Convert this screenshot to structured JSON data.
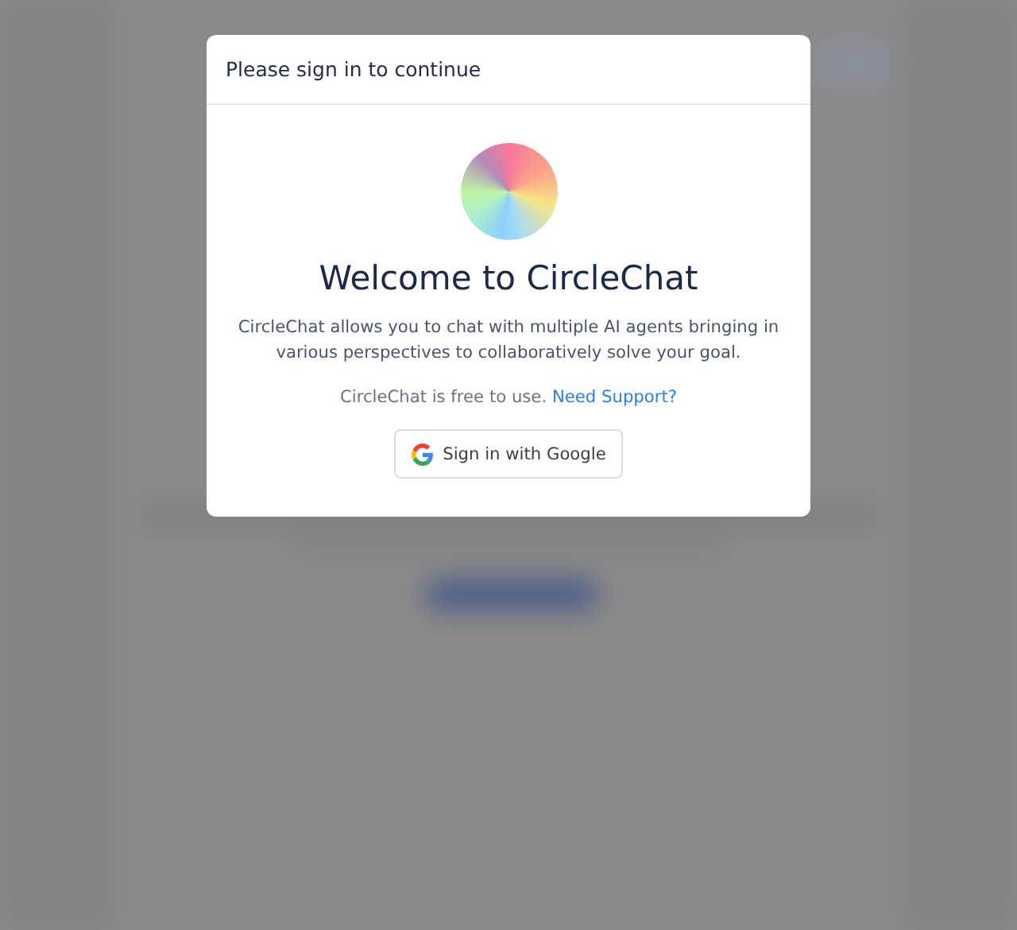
{
  "dialog": {
    "title": "Please sign in to continue",
    "heading": "Welcome to CircleChat",
    "description": "CircleChat allows you to chat with multiple AI agents bringing in various perspectives to collaboratively solve your goal.",
    "note": "CircleChat is free to use.",
    "support_link": "Need Support?",
    "sign_in_button": "Sign in with Google"
  }
}
